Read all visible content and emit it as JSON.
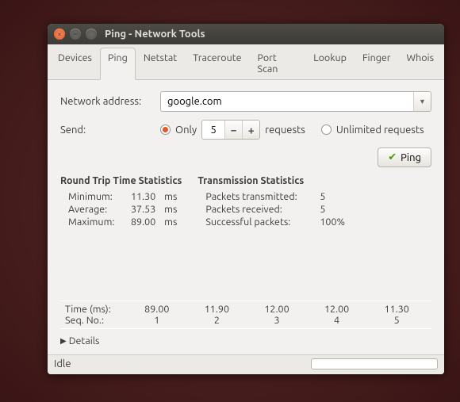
{
  "window": {
    "title": "Ping - Network Tools"
  },
  "tabs": [
    "Devices",
    "Ping",
    "Netstat",
    "Traceroute",
    "Port Scan",
    "Lookup",
    "Finger",
    "Whois"
  ],
  "active_tab": 1,
  "form": {
    "address_label": "Network address:",
    "address_value": "google.com",
    "send_label": "Send:",
    "only_label": "Only",
    "count_value": "5",
    "requests_word": "requests",
    "unlimited_label": "Unlimited requests",
    "ping_button": "Ping"
  },
  "rtt": {
    "heading": "Round Trip Time Statistics",
    "min_label": "Minimum:",
    "min_value": "11.30",
    "min_unit": "ms",
    "avg_label": "Average:",
    "avg_value": "37.53",
    "avg_unit": "ms",
    "max_label": "Maximum:",
    "max_value": "89.00",
    "max_unit": "ms"
  },
  "trans": {
    "heading": "Transmission Statistics",
    "tx_label": "Packets transmitted:",
    "tx_value": "5",
    "rx_label": "Packets received:",
    "rx_value": "5",
    "ok_label": "Successful packets:",
    "ok_value": "100%"
  },
  "results": {
    "time_label": "Time (ms):",
    "seq_label": "Seq. No.:",
    "cols": [
      {
        "time": "89.00",
        "seq": "1"
      },
      {
        "time": "11.90",
        "seq": "2"
      },
      {
        "time": "12.00",
        "seq": "3"
      },
      {
        "time": "12.00",
        "seq": "4"
      },
      {
        "time": "11.30",
        "seq": "5"
      }
    ]
  },
  "details_label": "Details",
  "status": "Idle"
}
